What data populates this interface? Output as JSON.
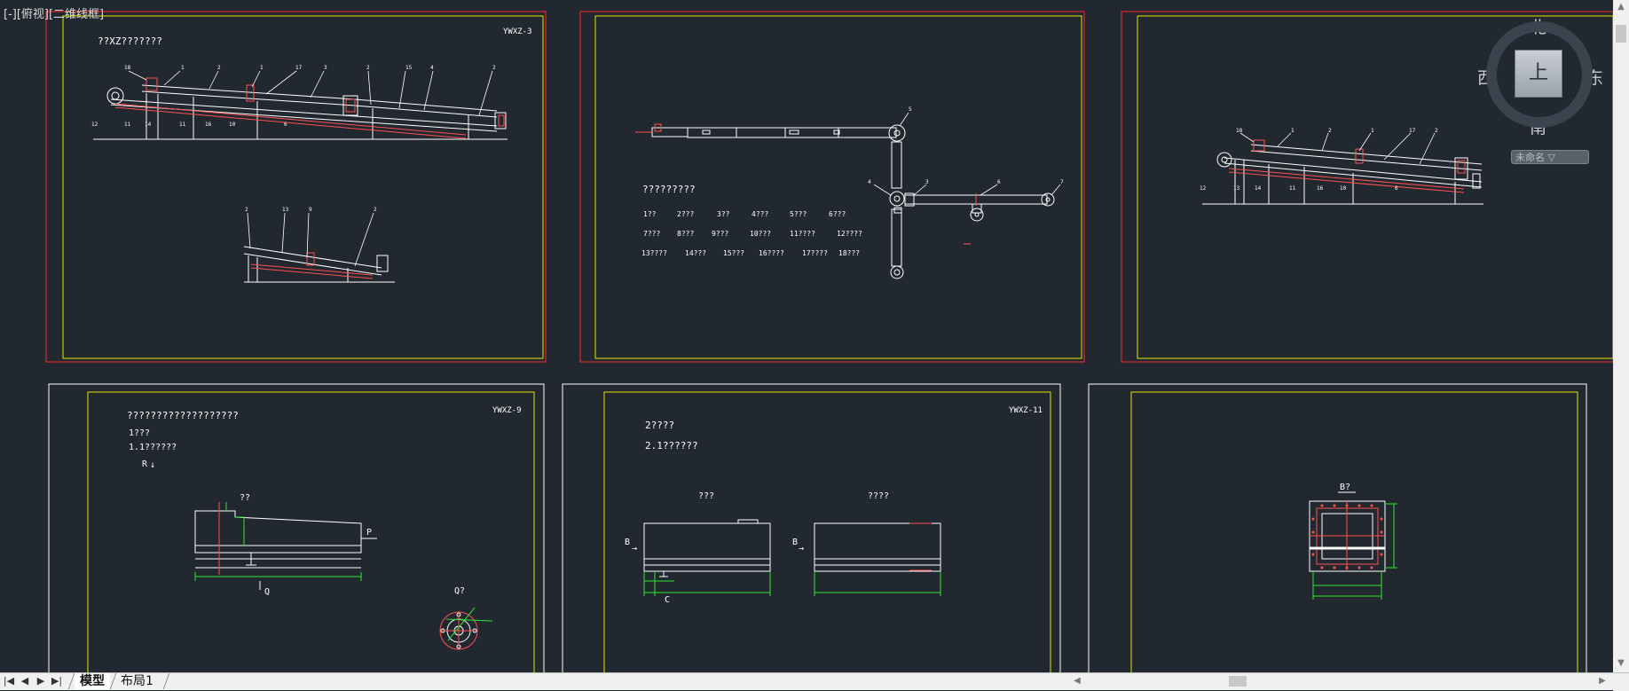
{
  "viewport": {
    "label": "[-][俯视][二维线框]"
  },
  "viewcube": {
    "north": "北",
    "south": "南",
    "east": "东",
    "west": "西",
    "top_face": "上",
    "ucs_label": "未命名 ▽"
  },
  "sheet1": {
    "code": "YWXZ-3",
    "title": "??XZ???????",
    "callouts": [
      "18",
      "1",
      "2",
      "1",
      "17",
      "3",
      "2",
      "15",
      "4",
      "2",
      "12",
      "11",
      "14",
      "11",
      "16",
      "10",
      "6",
      "2",
      "13",
      "9",
      "2"
    ]
  },
  "sheet2": {
    "title": "?????????",
    "legend_rows": [
      [
        "1??",
        "2???",
        "3??",
        "4???",
        "5???",
        "6???"
      ],
      [
        "7???",
        "8???",
        "9???",
        "10???",
        "11????",
        "12????"
      ],
      [
        "13????",
        "14???",
        "15???",
        "16????",
        "17????",
        "18???"
      ]
    ],
    "callouts": [
      "5",
      "4",
      "3",
      "6",
      "7"
    ]
  },
  "sheet3": {
    "callouts": [
      "18",
      "1",
      "2",
      "1",
      "17",
      "2",
      "12",
      "13",
      "14",
      "11",
      "16",
      "10",
      "6"
    ]
  },
  "sheet4": {
    "code": "YWXZ-9",
    "title": "???????????????????",
    "line1": "1???",
    "line2": "1.1??????",
    "label_r": "R",
    "label_view": "??",
    "label_p": "P",
    "label_q": "Q",
    "label_q2": "Q?"
  },
  "sheet5": {
    "code": "YWXZ-11",
    "line1": "2????",
    "line2": "2.1??????",
    "view_a": "???",
    "view_b": "????",
    "label_b": "B",
    "label_c": "C"
  },
  "sheet6": {
    "label_b": "B?"
  },
  "tabs": {
    "model": "模型",
    "layout": "布局1"
  },
  "nav": {
    "first": "|◀",
    "prev": "◀",
    "next": "▶",
    "last": "▶|"
  }
}
